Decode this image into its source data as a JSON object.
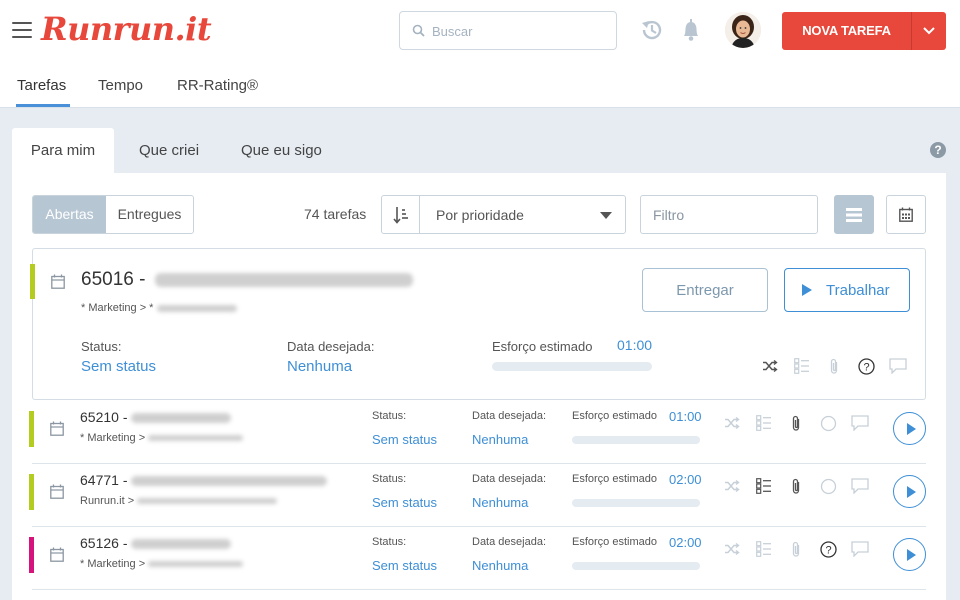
{
  "app": {
    "logo": "Runrun.it"
  },
  "header": {
    "search_placeholder": "Buscar",
    "new_task_label": "NOVA TAREFA"
  },
  "main_tabs": [
    {
      "label": "Tarefas",
      "active": true
    },
    {
      "label": "Tempo",
      "active": false
    },
    {
      "label": "RR-Rating®",
      "active": false
    }
  ],
  "sub_tabs": [
    {
      "label": "Para mim",
      "active": true
    },
    {
      "label": "Que criei",
      "active": false
    },
    {
      "label": "Que eu sigo",
      "active": false
    }
  ],
  "help_label": "?",
  "toolbar": {
    "segment": [
      "Abertas",
      "Entregues"
    ],
    "count": "74 tarefas",
    "sort_value": "Por prioridade",
    "filter_placeholder": "Filtro"
  },
  "featured": {
    "id_prefix": "65016 -",
    "crumb_prefix": "* Marketing > *",
    "status_label": "Status:",
    "status_value": "Sem status",
    "date_label": "Data desejada:",
    "date_value": "Nenhuma",
    "effort_label": "Esforço estimado",
    "effort_value": "01:00",
    "deliver_label": "Entregar",
    "work_label": "Trabalhar",
    "color": "#b3cc1f"
  },
  "rows": [
    {
      "id_prefix": "65210 -",
      "crumb_prefix": "* Marketing >",
      "status_label": "Status:",
      "status_value": "Sem status",
      "date_label": "Data desejada:",
      "date_value": "Nenhuma",
      "effort_label": "Esforço estimado",
      "effort_value": "01:00",
      "color": "#b3cc1f"
    },
    {
      "id_prefix": "64771 -",
      "crumb_prefix": "Runrun.it >",
      "status_label": "Status:",
      "status_value": "Sem status",
      "date_label": "Data desejada:",
      "date_value": "Nenhuma",
      "effort_label": "Esforço estimado",
      "effort_value": "02:00",
      "color": "#b3cc1f"
    },
    {
      "id_prefix": "65126 -",
      "crumb_prefix": "* Marketing >",
      "status_label": "Status:",
      "status_value": "Sem status",
      "date_label": "Data desejada:",
      "date_value": "Nenhuma",
      "effort_label": "Esforço estimado",
      "effort_value": "02:00",
      "color": "#d6127d"
    }
  ],
  "icons": {
    "menu": "hamburger-icon",
    "search": "search-icon",
    "history": "history-icon",
    "bell": "bell-icon",
    "calendar": "calendar-icon",
    "sort": "sort-icon",
    "list_view": "list-view-icon",
    "calendar_view": "calendar-view-icon",
    "shuffle": "shuffle-icon",
    "checklist": "checklist-icon",
    "attachment": "paperclip-icon",
    "question": "question-circle-icon",
    "comment": "comment-icon"
  },
  "colors": {
    "brand": "#e8483b",
    "accent": "#3e8fd6"
  }
}
